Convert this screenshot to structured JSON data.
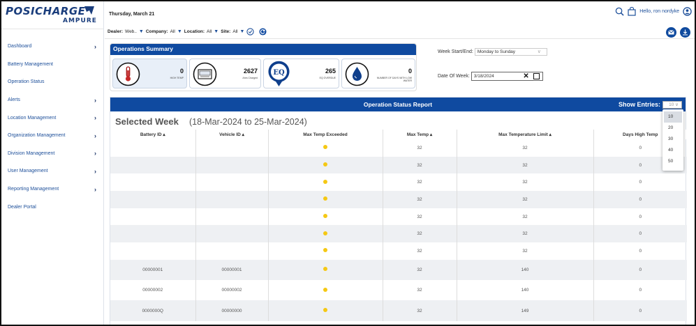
{
  "header": {
    "date": "Thursday, March 21",
    "greeting": "Hello, ron nordyke"
  },
  "logo": {
    "brand": "POSICHARGE",
    "sub": "AMPURE"
  },
  "filters": {
    "dealer_label": "Dealer:",
    "dealer_value": "Web..",
    "company_label": "Company:",
    "company_value": "All",
    "location_label": "Location:",
    "location_value": "All",
    "site_label": "Site:",
    "site_value": "All"
  },
  "sidebar": {
    "items": [
      {
        "label": "Dashboard",
        "chevron": true
      },
      {
        "label": "Battery Management",
        "chevron": false
      },
      {
        "label": "Operation Status",
        "chevron": false
      },
      {
        "label": "Alerts",
        "chevron": true
      },
      {
        "label": "Location Management",
        "chevron": true
      },
      {
        "label": "Organization Management",
        "chevron": true
      },
      {
        "label": "Division Management",
        "chevron": true
      },
      {
        "label": "User Management",
        "chevron": true
      },
      {
        "label": "Reporting Management",
        "chevron": true
      },
      {
        "label": "Dealer Portal",
        "chevron": false
      }
    ]
  },
  "summary": {
    "title": "Operations Summary",
    "cards": [
      {
        "value": "0",
        "label": "HIGH TEMP",
        "icon": "thermometer-icon"
      },
      {
        "value": "2627",
        "label": "Ahrs Charged",
        "icon": "battery-charger-icon"
      },
      {
        "value": "265",
        "label": "EQ OVERDUE",
        "icon": "eq-badge-icon",
        "icon_text": "EQ"
      },
      {
        "value": "0",
        "label": "NUMBER OF DAYS WITH LOW WATER",
        "icon": "water-drop-icon"
      }
    ]
  },
  "week_start": {
    "label": "Week Start/End:",
    "value": "Monday to Sunday"
  },
  "date_of_week": {
    "label": "Date Of Week:",
    "value": "3/18/2024"
  },
  "report": {
    "title": "Operation Status Report",
    "show_entries_label": "Show Entries:",
    "show_entries_value": "10",
    "entries_options": [
      "10",
      "20",
      "30",
      "40",
      "50"
    ],
    "selected_week_label": "Selected Week",
    "selected_week_range": "(18-Mar-2024 to 25-Mar-2024)",
    "columns": [
      "Battery ID ▴",
      "Vehicle ID ▴",
      "Max Temp Exceeded",
      "Max Temp ▴",
      "Max Temperature Limit ▴",
      "Days High Temp"
    ],
    "rows": [
      {
        "battery": "",
        "vehicle": "",
        "max_temp": "32",
        "limit": "32",
        "days": "0"
      },
      {
        "battery": "",
        "vehicle": "",
        "max_temp": "32",
        "limit": "32",
        "days": "0"
      },
      {
        "battery": "",
        "vehicle": "",
        "max_temp": "32",
        "limit": "32",
        "days": "0"
      },
      {
        "battery": "",
        "vehicle": "",
        "max_temp": "32",
        "limit": "32",
        "days": "0"
      },
      {
        "battery": "",
        "vehicle": "",
        "max_temp": "32",
        "limit": "32",
        "days": "0"
      },
      {
        "battery": "",
        "vehicle": "",
        "max_temp": "32",
        "limit": "32",
        "days": "0"
      },
      {
        "battery": "",
        "vehicle": "",
        "max_temp": "32",
        "limit": "32",
        "days": "0"
      },
      {
        "battery": "00000001",
        "vehicle": "00000001",
        "max_temp": "32",
        "limit": "140",
        "days": "0"
      },
      {
        "battery": "00000002",
        "vehicle": "00000002",
        "max_temp": "32",
        "limit": "140",
        "days": "0"
      },
      {
        "battery": "0000000Q",
        "vehicle": "00000000",
        "max_temp": "32",
        "limit": "149",
        "days": "0"
      }
    ]
  },
  "colors": {
    "primary": "#0f4aa0",
    "dot": "#f5c814",
    "nav_text": "#1d4f9a"
  }
}
